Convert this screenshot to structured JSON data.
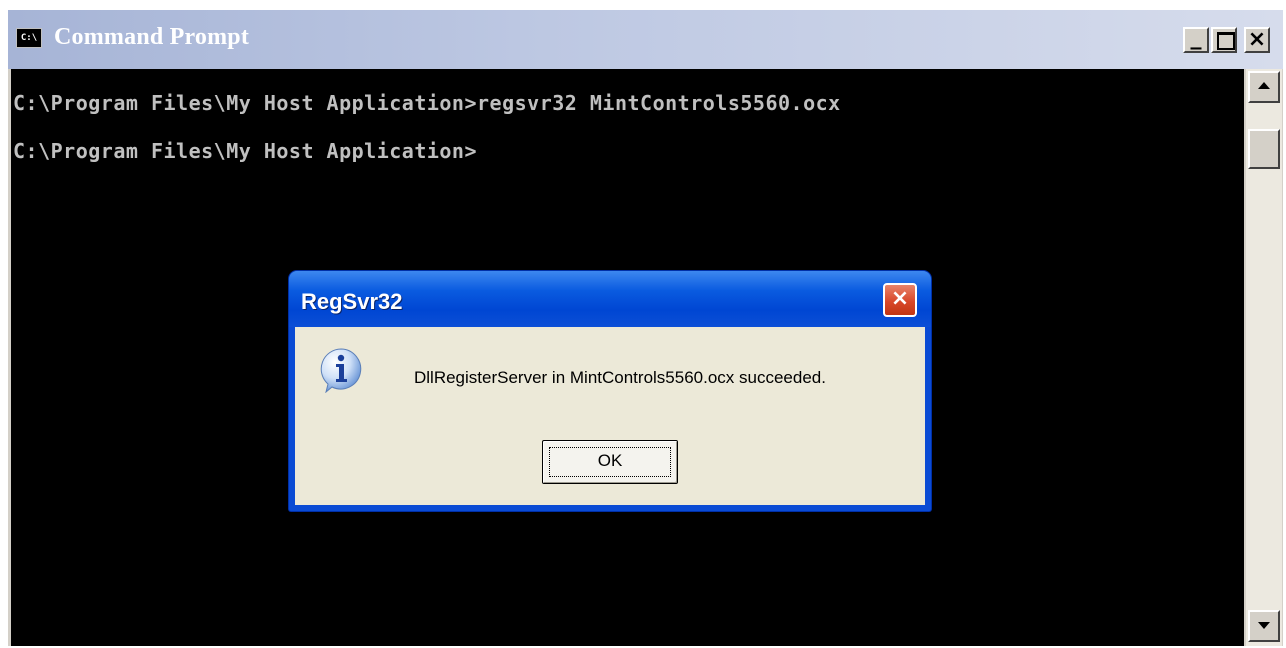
{
  "window": {
    "title": "Command Prompt",
    "icon_label": "C:\\",
    "minimize_label": "_",
    "close_label": "×"
  },
  "console": {
    "lines": [
      "C:\\Program Files\\My Host Application>regsvr32 MintControls5560.ocx",
      "C:\\Program Files\\My Host Application>"
    ]
  },
  "dialog": {
    "title": "RegSvr32",
    "message": "DllRegisterServer in MintControls5560.ocx succeeded.",
    "ok_label": "OK",
    "close_label": "×",
    "icon": "info-icon"
  },
  "colors": {
    "console_bg": "#000000",
    "console_text": "#c0c0c0",
    "dialog_title_blue": "#0046d3",
    "dialog_body": "#ece9d8",
    "close_red": "#d8482a"
  }
}
